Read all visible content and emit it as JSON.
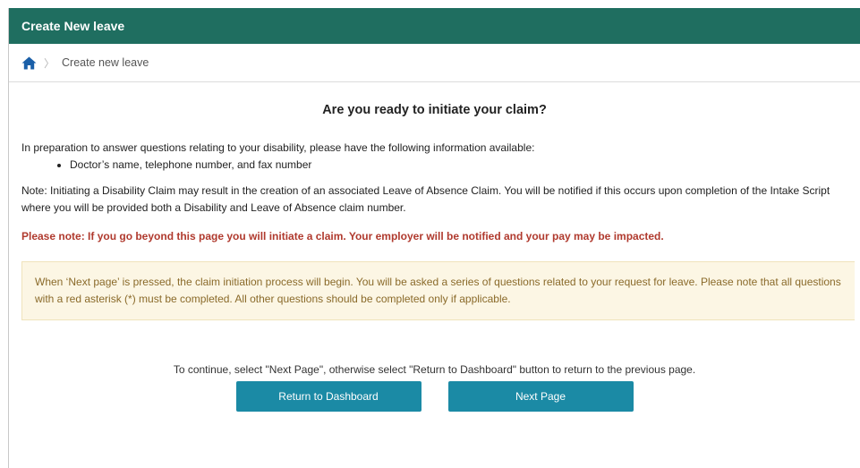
{
  "header": {
    "title": "Create New leave"
  },
  "breadcrumb": {
    "home_icon": "home-icon",
    "separator": "〉",
    "current": "Create new leave"
  },
  "main": {
    "heading": "Are you ready to initiate your claim?",
    "intro": "In preparation to answer questions relating to your disability, please have the following information available:",
    "info_items": [
      "Doctor’s name, telephone number, and fax number"
    ],
    "note": "Note: Initiating a Disability Claim may result in the creation of an associated Leave of Absence Claim. You will be notified if this occurs upon completion of the Intake Script where you will be provided both a Disability and Leave of Absence claim number.",
    "warning": "Please note: If you go beyond this page you will initiate a claim. Your employer will be notified and your pay may be impacted.",
    "info_box": "When ‘Next page’ is pressed, the claim initiation process will begin. You will be asked a series of questions related to your request for leave. Please note that all questions with a red asterisk (*) must be completed. All other questions should be completed only if applicable.",
    "continue_text": "To continue, select \"Next Page\", otherwise select \"Return to Dashboard\" button to return to the previous page."
  },
  "actions": {
    "return_label": "Return to Dashboard",
    "next_label": "Next Page"
  },
  "colors": {
    "header_bg": "#1f6e60",
    "button_bg": "#1b8aa5",
    "warning_text": "#b03a2e",
    "info_box_bg": "#fcf6e4",
    "info_box_text": "#8a6a2a"
  }
}
